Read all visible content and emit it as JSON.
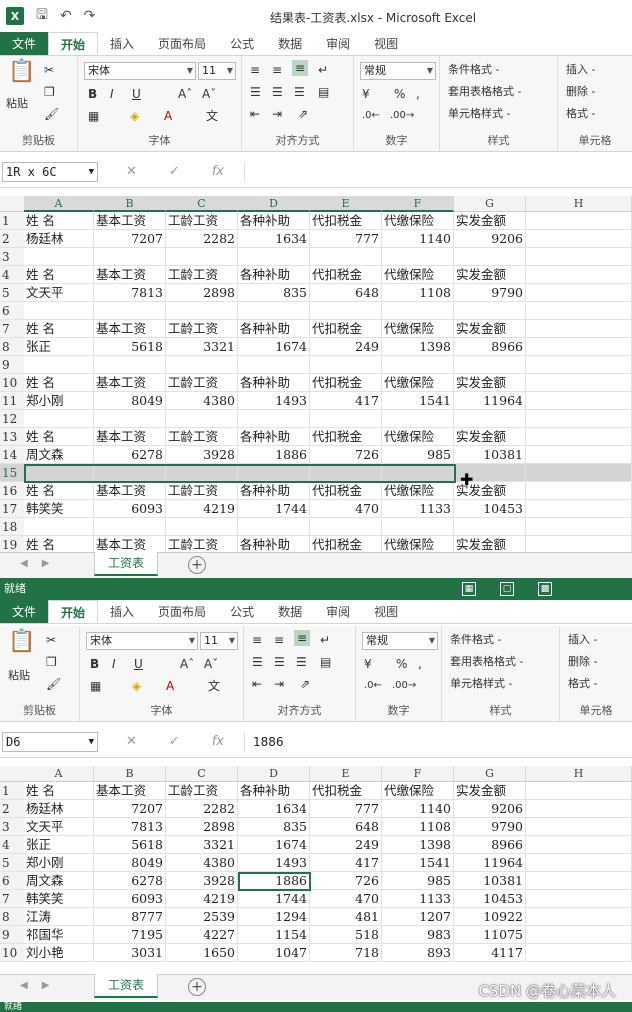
{
  "top": {
    "app_title": "结果表-工资表.xlsx - Microsoft Excel",
    "ribbon_tabs": [
      "文件",
      "开始",
      "插入",
      "页面布局",
      "公式",
      "数据",
      "审阅",
      "视图"
    ],
    "font_name": "宋体",
    "font_size": "11",
    "number_format": "常规",
    "clipboard": {
      "paste": "粘贴",
      "label": "剪贴板"
    },
    "groups": {
      "font": "字体",
      "align": "对齐方式",
      "number": "数字",
      "styles": "样式",
      "cells": "单元格"
    },
    "styles": {
      "cond": "条件格式 -",
      "table": "套用表格格式 -",
      "cell": "单元格样式 -"
    },
    "cells": {
      "insert": "插入 -",
      "delete": "删除 -",
      "format": "格式 -"
    },
    "name_box": "1R x 6C",
    "formula": "",
    "columns": [
      "A",
      "B",
      "C",
      "D",
      "E",
      "F",
      "G",
      "H"
    ],
    "rows": [
      {
        "n": "1",
        "cells": [
          "姓  名",
          "基本工资",
          "工龄工资",
          "各种补助",
          "代扣税金",
          "代缴保险",
          "实发金额"
        ],
        "hdr": true
      },
      {
        "n": "2",
        "cells": [
          "杨廷林",
          "7207",
          "2282",
          "1634",
          "777",
          "1140",
          "9206"
        ]
      },
      {
        "n": "3",
        "cells": []
      },
      {
        "n": "4",
        "cells": [
          "姓  名",
          "基本工资",
          "工龄工资",
          "各种补助",
          "代扣税金",
          "代缴保险",
          "实发金额"
        ],
        "hdr": true
      },
      {
        "n": "5",
        "cells": [
          "文天平",
          "7813",
          "2898",
          "835",
          "648",
          "1108",
          "9790"
        ]
      },
      {
        "n": "6",
        "cells": []
      },
      {
        "n": "7",
        "cells": [
          "姓  名",
          "基本工资",
          "工龄工资",
          "各种补助",
          "代扣税金",
          "代缴保险",
          "实发金额"
        ],
        "hdr": true
      },
      {
        "n": "8",
        "cells": [
          "张正",
          "5618",
          "3321",
          "1674",
          "249",
          "1398",
          "8966"
        ]
      },
      {
        "n": "9",
        "cells": []
      },
      {
        "n": "10",
        "cells": [
          "姓  名",
          "基本工资",
          "工龄工资",
          "各种补助",
          "代扣税金",
          "代缴保险",
          "实发金额"
        ],
        "hdr": true
      },
      {
        "n": "11",
        "cells": [
          "郑小刚",
          "8049",
          "4380",
          "1493",
          "417",
          "1541",
          "11964"
        ]
      },
      {
        "n": "12",
        "cells": []
      },
      {
        "n": "13",
        "cells": [
          "姓  名",
          "基本工资",
          "工龄工资",
          "各种补助",
          "代扣税金",
          "代缴保险",
          "实发金额"
        ],
        "hdr": true
      },
      {
        "n": "14",
        "cells": [
          "周文森",
          "6278",
          "3928",
          "1886",
          "726",
          "985",
          "10381"
        ]
      },
      {
        "n": "15",
        "cells": [],
        "selected": true
      },
      {
        "n": "16",
        "cells": [
          "姓  名",
          "基本工资",
          "工龄工资",
          "各种补助",
          "代扣税金",
          "代缴保险",
          "实发金额"
        ],
        "hdr": true
      },
      {
        "n": "17",
        "cells": [
          "韩笑笑",
          "6093",
          "4219",
          "1744",
          "470",
          "1133",
          "10453"
        ]
      },
      {
        "n": "18",
        "cells": []
      },
      {
        "n": "19",
        "cells": [
          "姓  名",
          "基本工资",
          "工龄工资",
          "各种补助",
          "代扣税金",
          "代缴保险",
          "实发金额"
        ],
        "hdr": true
      }
    ],
    "sheet_tab": "工资表",
    "status": "就绪"
  },
  "bottom": {
    "ribbon_tabs": [
      "文件",
      "开始",
      "插入",
      "页面布局",
      "公式",
      "数据",
      "审阅",
      "视图"
    ],
    "font_name": "宋体",
    "font_size": "11",
    "number_format": "常规",
    "clipboard": {
      "paste": "粘贴",
      "label": "剪贴板"
    },
    "groups": {
      "font": "字体",
      "align": "对齐方式",
      "number": "数字",
      "styles": "样式",
      "cells": "单元格"
    },
    "styles": {
      "cond": "条件格式 -",
      "table": "套用表格格式 -",
      "cell": "单元格样式 -"
    },
    "cells": {
      "insert": "插入 -",
      "delete": "删除 -",
      "format": "格式 -"
    },
    "name_box": "D6",
    "formula": "1886",
    "columns": [
      "A",
      "B",
      "C",
      "D",
      "E",
      "F",
      "G",
      "H"
    ],
    "rows": [
      {
        "n": "1",
        "cells": [
          "姓  名",
          "基本工资",
          "工龄工资",
          "各种补助",
          "代扣税金",
          "代缴保险",
          "实发金额"
        ],
        "hdr": true
      },
      {
        "n": "2",
        "cells": [
          "杨廷林",
          "7207",
          "2282",
          "1634",
          "777",
          "1140",
          "9206"
        ]
      },
      {
        "n": "3",
        "cells": [
          "文天平",
          "7813",
          "2898",
          "835",
          "648",
          "1108",
          "9790"
        ]
      },
      {
        "n": "4",
        "cells": [
          "张正",
          "5618",
          "3321",
          "1674",
          "249",
          "1398",
          "8966"
        ]
      },
      {
        "n": "5",
        "cells": [
          "郑小刚",
          "8049",
          "4380",
          "1493",
          "417",
          "1541",
          "11964"
        ]
      },
      {
        "n": "6",
        "cells": [
          "周文森",
          "6278",
          "3928",
          "1886",
          "726",
          "985",
          "10381"
        ]
      },
      {
        "n": "7",
        "cells": [
          "韩笑笑",
          "6093",
          "4219",
          "1744",
          "470",
          "1133",
          "10453"
        ]
      },
      {
        "n": "8",
        "cells": [
          "江涛",
          "8777",
          "2539",
          "1294",
          "481",
          "1207",
          "10922"
        ]
      },
      {
        "n": "9",
        "cells": [
          "祁国华",
          "7195",
          "4227",
          "1154",
          "518",
          "983",
          "11075"
        ]
      },
      {
        "n": "10",
        "cells": [
          "刘小艳",
          "3031",
          "1650",
          "1047",
          "718",
          "893",
          "4117"
        ]
      }
    ],
    "sheet_tab": "工资表",
    "status": "就绪"
  },
  "watermark": "CSDN @卷心菜本人",
  "colors": {
    "accent": "#217346",
    "selection": "#d4d4d4"
  }
}
